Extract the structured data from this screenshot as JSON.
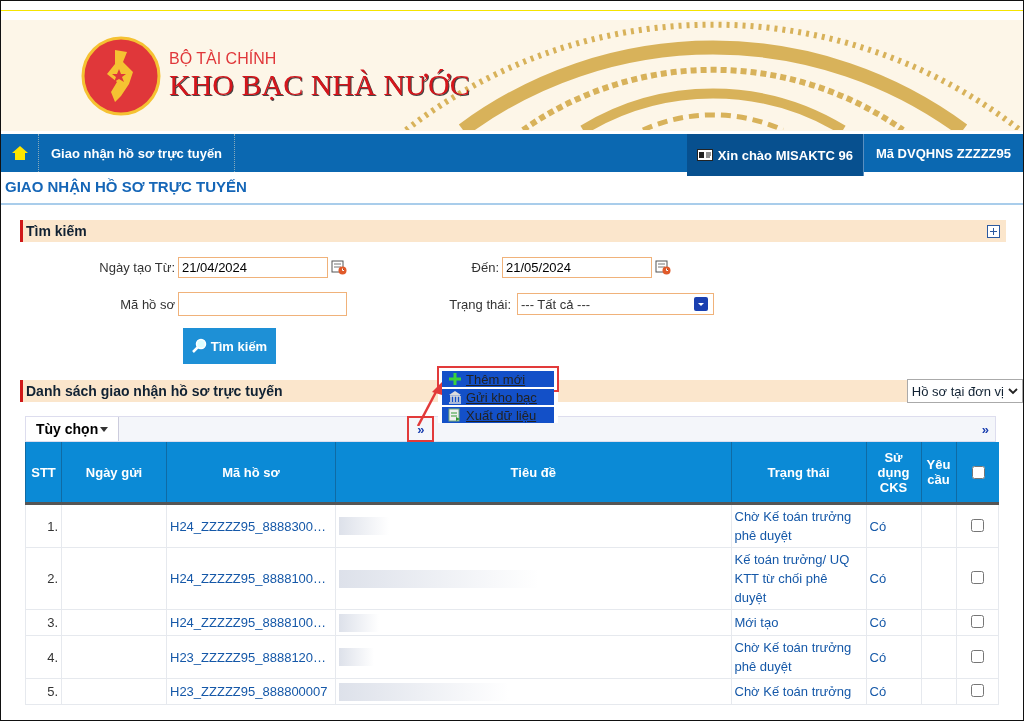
{
  "header": {
    "ministry": "BỘ TÀI CHÍNH",
    "agency": "KHO BẠC NHÀ NƯỚC"
  },
  "nav": {
    "items": [
      {
        "label": "Giao nhận hồ sơ trực tuyến"
      }
    ],
    "greeting": "Xin chào MISAKTC 96",
    "unit_code": "Mã DVQHNS ZZZZZ95"
  },
  "page_title": "GIAO NHẬN HỒ SƠ TRỰC TUYẾN",
  "search": {
    "title": "Tìm kiếm",
    "from_label": "Ngày tạo Từ:",
    "from_value": "21/04/2024",
    "to_label": "Đến:",
    "to_value": "21/05/2024",
    "code_label": "Mã hồ sơ",
    "status_label": "Trạng thái:",
    "status_value": "--- Tất cả ---",
    "button": "Tìm kiếm"
  },
  "actions": [
    {
      "kind": "add",
      "label": "Thêm mới",
      "highlighted": true
    },
    {
      "kind": "send",
      "label": "Gửi kho bạc",
      "highlighted": false
    },
    {
      "kind": "export",
      "label": "Xuất dữ liệu",
      "highlighted": false
    }
  ],
  "list": {
    "title": "Danh sách giao nhận hồ sơ trực tuyến",
    "filter": "Hồ sơ tại đơn vị",
    "options_label": "Tùy chọn",
    "expand": "»",
    "expand_highlighted": true,
    "expand_right": "»",
    "columns": [
      "STT",
      "Ngày gửi",
      "Mã hồ sơ",
      "Tiêu đề",
      "Trạng thái",
      "Sử dụng CKS",
      "Yêu cầu"
    ],
    "select_all_checked": false,
    "rows": [
      {
        "stt": "1.",
        "code": "H24_ZZZZZ95_8888300…",
        "status": "Chờ Kế toán trưởng phê duyệt",
        "cks": "Có",
        "checked": false
      },
      {
        "stt": "2.",
        "code": "H24_ZZZZZ95_8888100…",
        "status": "Kế toán trưởng/ UQ KTT từ chối phê duyệt",
        "cks": "Có",
        "checked": false
      },
      {
        "stt": "3.",
        "code": "H24_ZZZZZ95_8888100…",
        "status": "Mới tạo",
        "cks": "Có",
        "checked": false
      },
      {
        "stt": "4.",
        "code": "H23_ZZZZZ95_8888120…",
        "status": "Chờ Kế toán trưởng phê duyệt",
        "cks": "Có",
        "checked": false
      },
      {
        "stt": "5.",
        "code": "H23_ZZZZZ95_888800007",
        "status": "Chờ Kế toán trưởng",
        "cks": "Có",
        "checked": false
      }
    ]
  }
}
